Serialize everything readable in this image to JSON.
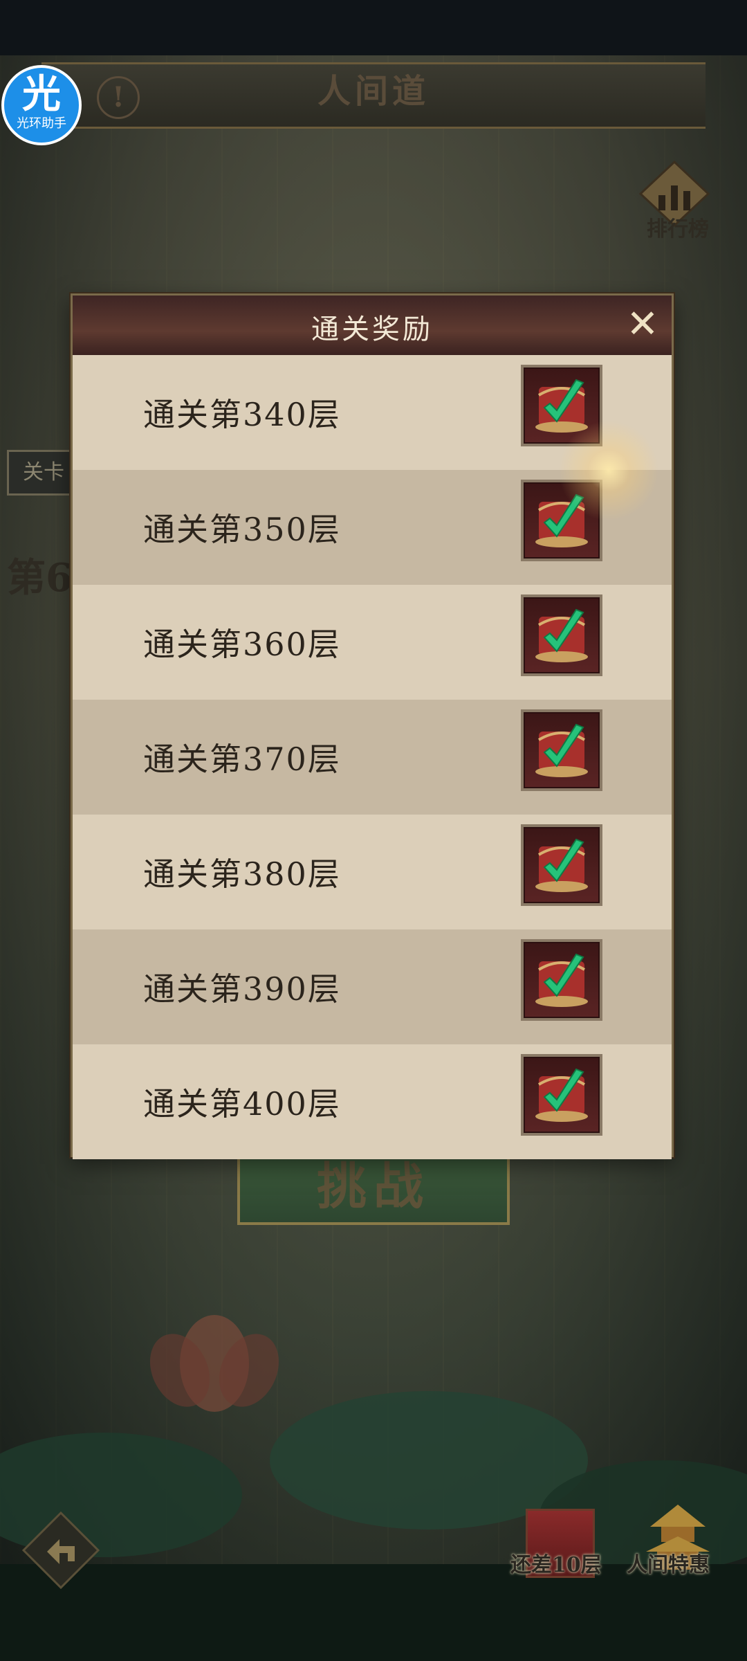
{
  "header": {
    "title": "人间道",
    "warning_glyph": "!"
  },
  "app_badge": {
    "glyph": "光",
    "label": "光环助手"
  },
  "ranking": {
    "label": "排行榜"
  },
  "side": {
    "tag_label": "关卡",
    "floor_label": "第6"
  },
  "challenge": {
    "label": "挑战"
  },
  "bottom": {
    "item_label": "还差10层",
    "special_label": "人间特惠"
  },
  "modal": {
    "title": "通关奖励",
    "close_glyph": "✕",
    "rewards": [
      {
        "label": "通关第340层"
      },
      {
        "label": "通关第350层"
      },
      {
        "label": "通关第360层"
      },
      {
        "label": "通关第370层"
      },
      {
        "label": "通关第380层"
      },
      {
        "label": "通关第390层"
      },
      {
        "label": "通关第400层"
      }
    ]
  },
  "colors": {
    "modal_header": "#4a2b26",
    "row_light": "#dccfb9",
    "row_dark": "#c6b8a2",
    "claimed_check": "#26c27a"
  }
}
